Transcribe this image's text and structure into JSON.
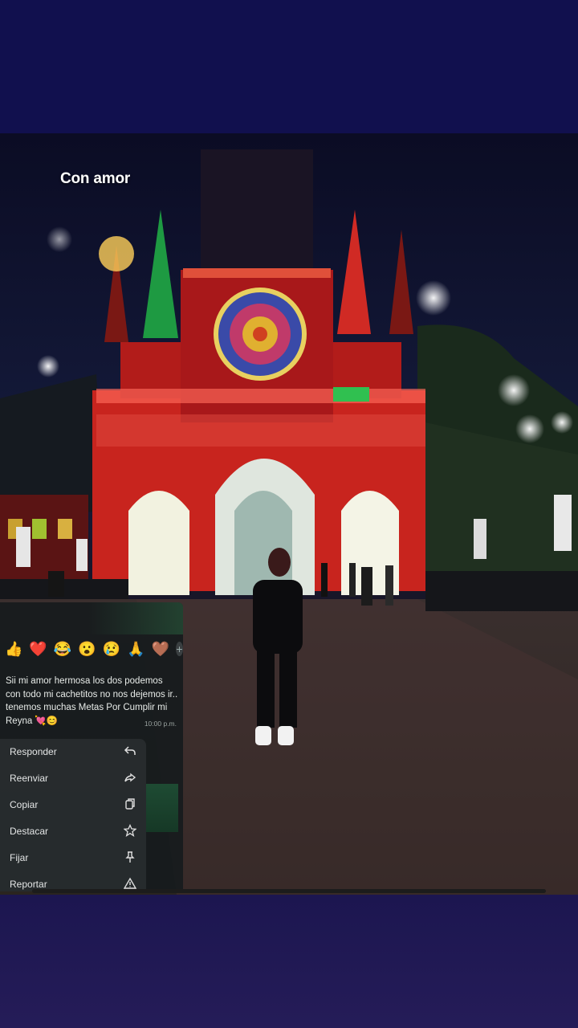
{
  "caption": "Con amor",
  "reactions": [
    "👍",
    "❤️",
    "😂",
    "😮",
    "😢",
    "🙏",
    "🤎"
  ],
  "reaction_more": "+",
  "message": {
    "text": "Sii mi amor hermosa los dos podemos con todo mi cachetitos no nos dejemos ir.. tenemos muchas Metas Por Cumplir mi Reyna 💘😊",
    "time": "10:00 p.m."
  },
  "menu": {
    "reply": "Responder",
    "forward": "Reenviar",
    "copy": "Copiar",
    "star": "Destacar",
    "pin": "Fijar",
    "report": "Reportar"
  }
}
